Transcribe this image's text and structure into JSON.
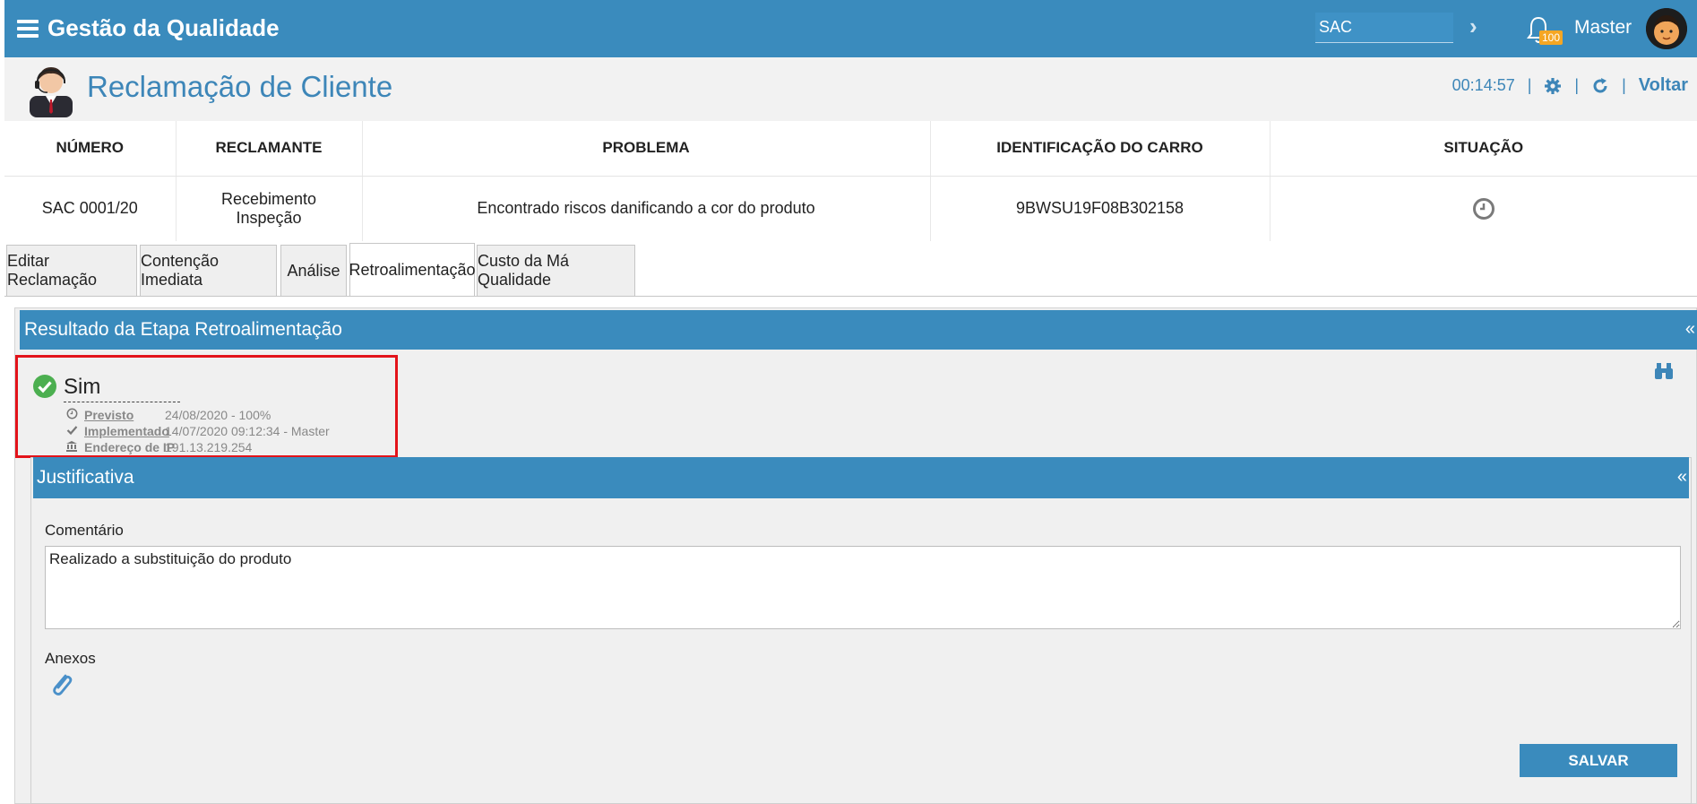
{
  "topbar": {
    "title": "Gestão da Qualidade",
    "search_value": "SAC",
    "notification_count": "100",
    "user_name": "Master"
  },
  "header": {
    "title": "Reclamação de Cliente",
    "timer": "00:14:57",
    "back_label": "Voltar"
  },
  "table": {
    "columns": [
      "NÚMERO",
      "RECLAMANTE",
      "PROBLEMA",
      "IDENTIFICAÇÃO DO CARRO",
      "SITUAÇÃO"
    ],
    "row": {
      "numero": "SAC 0001/20",
      "reclamante_line1": "Recebimento",
      "reclamante_line2": "Inspeção",
      "problema": "Encontrado riscos danificando a cor do produto",
      "carro": "9BWSU19F08B302158",
      "situacao_icon": "clock-icon"
    }
  },
  "tabs": [
    {
      "label": "Editar Reclamação"
    },
    {
      "label": "Contenção Imediata"
    },
    {
      "label": "Análise"
    },
    {
      "label": "Retroalimentação"
    },
    {
      "label": "Custo da Má Qualidade"
    }
  ],
  "active_tab": "Retroalimentação",
  "panel": {
    "title": "Resultado da Etapa Retroalimentação",
    "collapse": "«"
  },
  "result": {
    "status": "Sim",
    "previsto_label": "Previsto",
    "previsto_value": "24/08/2020 - 100%",
    "implementado_label": "Implementado",
    "implementado_value": "14/07/2020 09:12:34 - Master",
    "ip_label": "Endereço de IP",
    "ip_value": "191.13.219.254"
  },
  "justificativa": {
    "title": "Justificativa",
    "collapse": "«",
    "comment_label": "Comentário",
    "comment_value": "Realizado a substituição do produto",
    "attachments_label": "Anexos",
    "save_label": "SALVAR"
  },
  "colors": {
    "primary": "#3a8bbd",
    "highlight": "#e3131a",
    "success": "#4caf50",
    "badge": "#f5a623"
  }
}
